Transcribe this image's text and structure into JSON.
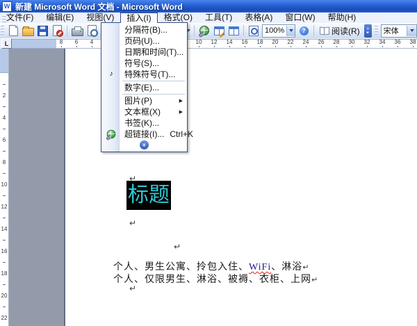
{
  "window": {
    "title": "新建 Microsoft Word 文档 - Microsoft Word",
    "app_icon": "W"
  },
  "menu_bar": {
    "items": [
      {
        "label": "文件(F)"
      },
      {
        "label": "编辑(E)"
      },
      {
        "label": "视图(V)"
      },
      {
        "label": "插入(I)",
        "active": true
      },
      {
        "label": "格式(O)"
      },
      {
        "label": "工具(T)"
      },
      {
        "label": "表格(A)"
      },
      {
        "label": "窗口(W)"
      },
      {
        "label": "帮助(H)"
      }
    ]
  },
  "toolbar": {
    "icons": [
      "new-document",
      "open-folder",
      "save",
      "permission",
      "print",
      "print-preview",
      "spell-check",
      "hyperlink-globe",
      "tables-and-borders",
      "insert-table",
      "zoom-page",
      "zoom-combo",
      "help",
      "read-mode",
      "toolbar-options",
      "font-combo"
    ],
    "zoom_value": "100%",
    "read_label": "阅读(R)",
    "font_name": "宋体"
  },
  "insert_menu": {
    "items": [
      {
        "label": "分隔符(B)..."
      },
      {
        "label": "页码(U)..."
      },
      {
        "label": "日期和时间(T)..."
      },
      {
        "label": "符号(S)..."
      },
      {
        "label": "特殊符号(T)...",
        "icon_special": true,
        "sep_after": true
      },
      {
        "label": "数字(E)...",
        "sep_after": true
      },
      {
        "label": "图片(P)",
        "submenu": true
      },
      {
        "label": "文本框(X)",
        "submenu": true
      },
      {
        "label": "书签(K)..."
      },
      {
        "label": "超链接(I)...",
        "icon_hyperlink": true,
        "shortcut": "Ctrl+K"
      }
    ],
    "expand_glyph": "»"
  },
  "ruler": {
    "tab_selector": "L",
    "h_numbers_left": [
      "8",
      "6",
      "4"
    ],
    "h_numbers_right": [
      "10",
      "12",
      "14",
      "16",
      "18",
      "20",
      "22",
      "24",
      "26",
      "28",
      "30",
      "32",
      "34",
      "36",
      "38"
    ],
    "v_numbers": [
      "2",
      "4",
      "6",
      "8",
      "10",
      "12",
      "14",
      "16",
      "18",
      "20",
      "22"
    ]
  },
  "document": {
    "pilcrow": "↵",
    "selected_title": "标题",
    "selection_colors": {
      "background": "#000000",
      "text": "#2FC8D2"
    },
    "line1_pre": "个人、男生公寓、拎包入住、",
    "line1_wavy": "WiFi",
    "line1_post": "、淋浴",
    "line2": "个人、仅限男生、淋浴、被褥、衣柜、上网"
  },
  "colors": {
    "titlebar_blue": "#2560D4",
    "toolbar_bg": "#E3EBF8",
    "document_gray": "#939BAB",
    "menu_border": "#33508F",
    "wavy_underline": "#E02020"
  }
}
